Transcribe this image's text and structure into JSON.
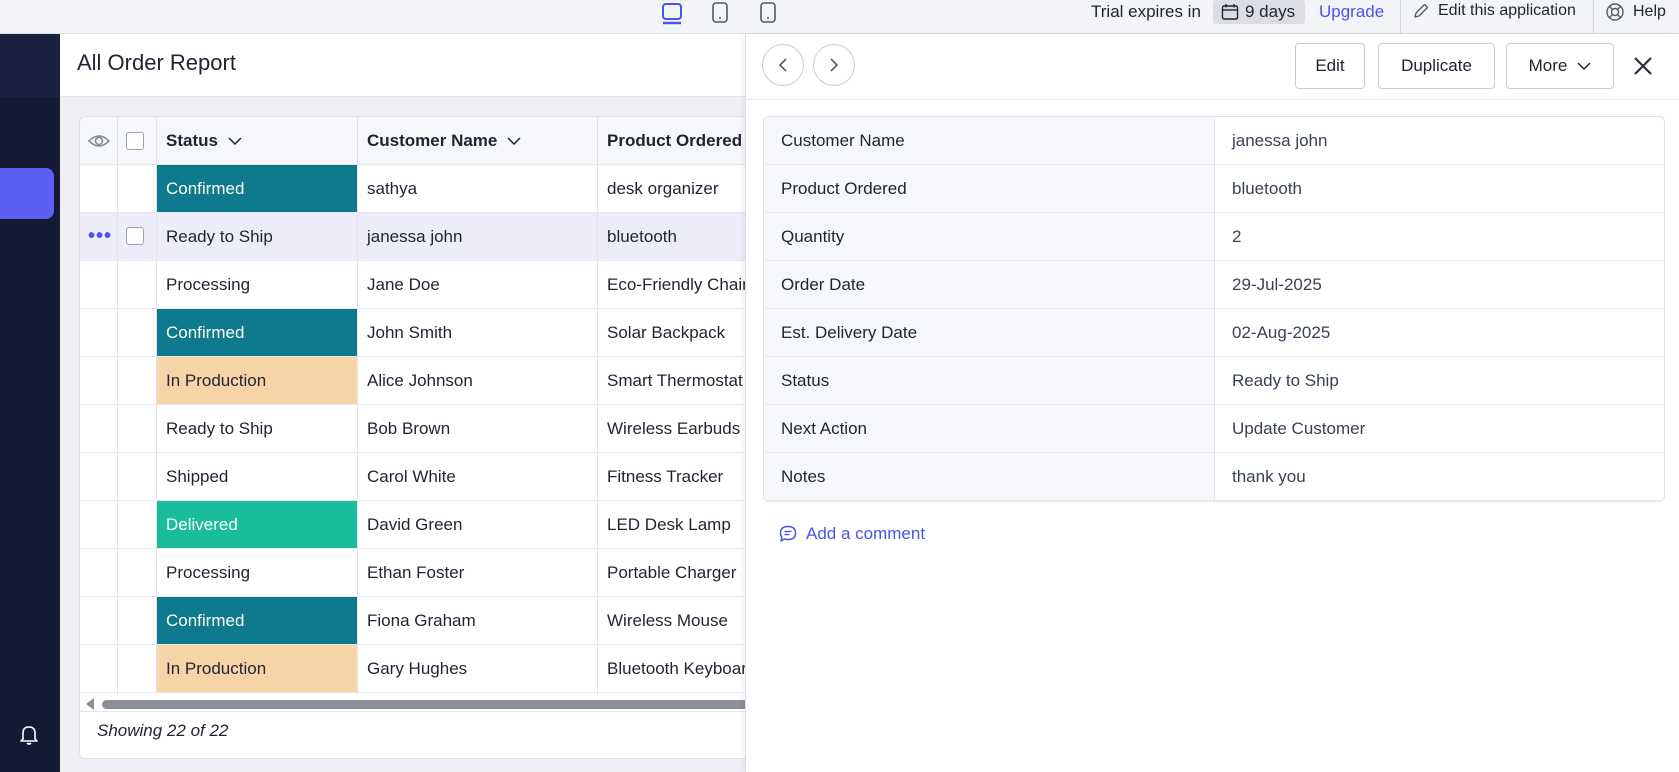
{
  "topbar": {
    "trial_text": "Trial expires in",
    "days": "9 days",
    "upgrade": "Upgrade",
    "edit_app": "Edit this application",
    "help": "Help",
    "icons": [
      "desktop-icon",
      "tablet-icon",
      "mobile-icon",
      "calendar-icon",
      "pencil-icon",
      "lifebuoy-icon"
    ]
  },
  "report": {
    "title": "All Order Report",
    "columns": {
      "status": "Status",
      "customer": "Customer Name",
      "product": "Product Ordered"
    },
    "rows": [
      {
        "status": "Confirmed",
        "customer": "sathya",
        "product": "desk organizer"
      },
      {
        "status": "Ready to Ship",
        "customer": "janessa john",
        "product": "bluetooth"
      },
      {
        "status": "Processing",
        "customer": "Jane Doe",
        "product": "Eco-Friendly Chair"
      },
      {
        "status": "Confirmed",
        "customer": "John Smith",
        "product": "Solar Backpack"
      },
      {
        "status": "In Production",
        "customer": "Alice Johnson",
        "product": "Smart Thermostat"
      },
      {
        "status": "Ready to Ship",
        "customer": "Bob Brown",
        "product": "Wireless Earbuds"
      },
      {
        "status": "Shipped",
        "customer": "Carol White",
        "product": "Fitness Tracker"
      },
      {
        "status": "Delivered",
        "customer": "David Green",
        "product": "LED Desk Lamp"
      },
      {
        "status": "Processing",
        "customer": "Ethan Foster",
        "product": "Portable Charger"
      },
      {
        "status": "Confirmed",
        "customer": "Fiona Graham",
        "product": "Wireless Mouse"
      },
      {
        "status": "In Production",
        "customer": "Gary Hughes",
        "product": "Bluetooth Keyboard"
      }
    ],
    "showing": "Showing 22 of 22",
    "status_colors": {
      "Confirmed": "#0d7a8e",
      "In Production": "#f7d4a8",
      "Delivered": "#1bbc9b"
    }
  },
  "panel": {
    "edit": "Edit",
    "duplicate": "Duplicate",
    "more": "More",
    "fields": [
      {
        "label": "Customer Name",
        "value": "janessa john"
      },
      {
        "label": "Product Ordered",
        "value": "bluetooth"
      },
      {
        "label": "Quantity",
        "value": "2"
      },
      {
        "label": "Order Date",
        "value": "29-Jul-2025"
      },
      {
        "label": "Est. Delivery Date",
        "value": "02-Aug-2025"
      },
      {
        "label": "Status",
        "value": "Ready to Ship"
      },
      {
        "label": "Next Action",
        "value": "Update Customer"
      },
      {
        "label": "Notes",
        "value": "thank you"
      }
    ],
    "add_comment": "Add a comment"
  },
  "colors": {
    "accent": "#4a55e6",
    "nav_bg": "#141a33",
    "nav_active": "#5b5ff2"
  }
}
